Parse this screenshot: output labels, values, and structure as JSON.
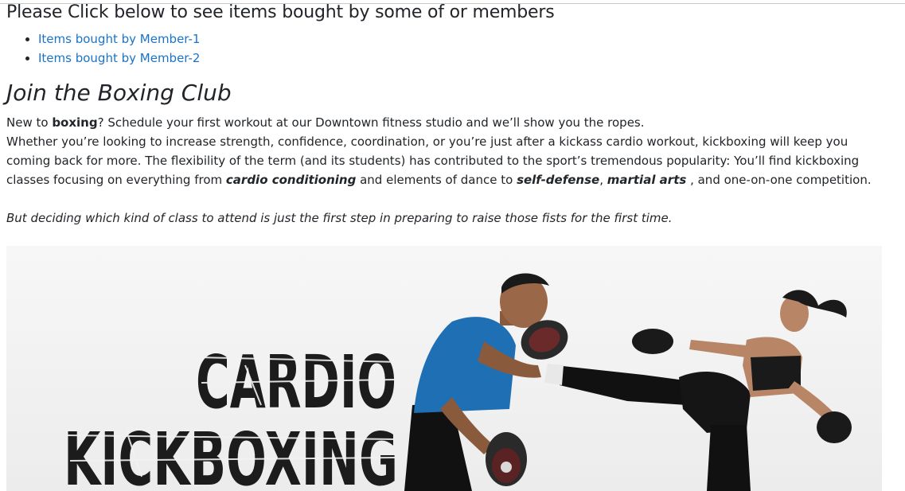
{
  "members_section": {
    "heading": "Please Click below to see items bought by some of or members",
    "links": [
      "Items bought by Member-1",
      "Items bought by Member-2"
    ]
  },
  "club": {
    "title": "Join the Boxing Club",
    "line1_pre": "New to ",
    "line1_bold": "boxing",
    "line1_post": "? Schedule your first workout at our Downtown fitness studio and we’ll show you the ropes.",
    "para_pre": "Whether you’re looking to increase strength, confidence, coordination, or you’re just after a kickass cardio workout, kickboxing will keep you coming back for more. The flexibility of the term (and its students) has contributed to the sport’s tremendous popularity: You’ll find kickboxing classes focusing on everything from ",
    "emph1": "cardio conditioning",
    "para_mid": " and elements of dance to ",
    "emph2": "self-defense",
    "comma": ", ",
    "emph3": "martial arts",
    "para_post": " , and one-on-one competition.",
    "closing": "But deciding which kind of class to attend is just the first step in preparing to raise those fists for the first time."
  },
  "hero_image": {
    "line1": "CARDIO",
    "line2": "KICKBOXING"
  },
  "colors": {
    "link": "#1a73c8",
    "text": "#212529",
    "shirt": "#1f6fb5"
  }
}
